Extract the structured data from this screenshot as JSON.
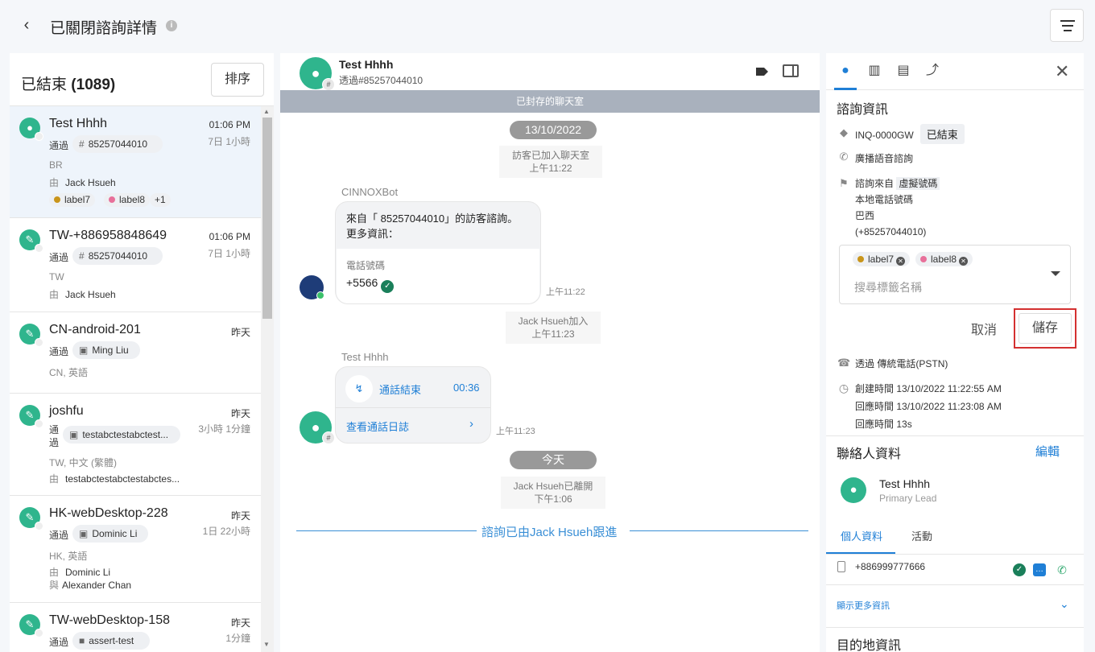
{
  "header": {
    "back_label": "‹",
    "title": "已關閉諮詢詳情",
    "info_glyph": "i"
  },
  "left": {
    "title": "已結束",
    "count": "(1089)",
    "sort_label": "排序",
    "items": [
      {
        "name": "Test Hhhh",
        "time": "01:06 PM",
        "age": "7日 1小時",
        "via": "通過",
        "chip": "85257044010",
        "chip_icon": "#",
        "sub": "BR",
        "by_pre": "由",
        "by": "Jack Hsueh",
        "labels": [
          {
            "text": "label7",
            "color": "#c9951a"
          },
          {
            "text": "label8",
            "color": "#e8709a"
          }
        ],
        "more": "+1"
      },
      {
        "name": "TW-+886958848649",
        "time": "01:06 PM",
        "age": "7日 1小時",
        "via": "通過",
        "chip": "85257044010",
        "chip_icon": "#",
        "sub": "TW",
        "by_pre": "由",
        "by": "Jack Hsueh"
      },
      {
        "name": "CN-android-201",
        "time": "昨天",
        "via": "通過",
        "chip": "Ming Liu",
        "chip_icon": "▣",
        "sub": "CN, 英語"
      },
      {
        "name": "joshfu",
        "time": "昨天",
        "age": "3小時 1分鐘",
        "via1": "通",
        "via2": "過",
        "chip": "testabctestabctest...",
        "chip_icon": "▣",
        "sub": "TW, 中文 (繁體)",
        "by_pre": "由",
        "by": "testabctestabctestabctes..."
      },
      {
        "name": "HK-webDesktop-228",
        "time": "昨天",
        "age": "1日 22小時",
        "via": "通過",
        "chip": "Dominic Li",
        "chip_icon": "▣",
        "sub": "HK, 英語",
        "by_pre": "由",
        "by": "Dominic Li",
        "with_pre": "與",
        "with": "Alexander Chan"
      },
      {
        "name": "TW-webDesktop-158",
        "time": "昨天",
        "age": "1分鐘",
        "via": "通過",
        "chip": "assert-test",
        "chip_icon": "■"
      }
    ]
  },
  "chat": {
    "contact_name": "Test Hhhh",
    "contact_via": "透過#85257044010",
    "archived": "已封存的聊天室",
    "date1": "13/10/2022",
    "sys1_a": "訪客已加入聊天室",
    "sys1_b": "上午11:22",
    "bot_name": "CINNOXBot",
    "bot_msg_1": "來自「 85257044010」的訪客諮詢。",
    "bot_msg_2": "更多資訊：",
    "phone_label": "電話號碼",
    "phone_value": "+5566",
    "bot_time": "上午11:22",
    "sys2_a": "Jack Hsueh加入",
    "sys2_b": "上午11:23",
    "visitor_name": "Test Hhhh",
    "call_end": "通話結束",
    "call_dur": "00:36",
    "call_log": "查看通話日誌",
    "call_time": "上午11:23",
    "date2": "今天",
    "sys3_a": "Jack Hsueh已離開",
    "sys3_b": "下午1:06",
    "follow": "諮詢已由Jack Hsueh跟進"
  },
  "right": {
    "section_inquiry": "諮詢資訊",
    "inquiry_id": "INQ-0000GW",
    "status": "已結束",
    "channel": "廣播語音諮詢",
    "from_label": "諮詢來自",
    "from_type": "虛擬號碼",
    "from_line2": "本地電話號碼",
    "from_line3": "巴西",
    "from_line4": "(+85257044010)",
    "tags": [
      {
        "text": "label7",
        "color": "#c9951a"
      },
      {
        "text": "label8",
        "color": "#e8709a"
      }
    ],
    "tag_placeholder": "搜尋標籤名稱",
    "cancel": "取消",
    "save": "儲存",
    "via": "透過",
    "via_type": "傳統電話(PSTN)",
    "created_label": "創建時間",
    "created": "13/10/2022 11:22:55 AM",
    "replied_label": "回應時間",
    "replied": "13/10/2022 11:23:08 AM",
    "resp_label": "回應時間",
    "resp": "13s",
    "section_contact": "聯絡人資料",
    "edit": "編輯",
    "contact_name": "Test Hhhh",
    "contact_role": "Primary Lead",
    "tab_profile": "個人資料",
    "tab_activity": "活動",
    "phone": "+886999777666",
    "more": "顯示更多資訊",
    "section_dest": "目的地資訊"
  },
  "colors": {
    "accent": "#1f7fd6",
    "green": "#2fb58d",
    "highlight": "#d43030"
  }
}
